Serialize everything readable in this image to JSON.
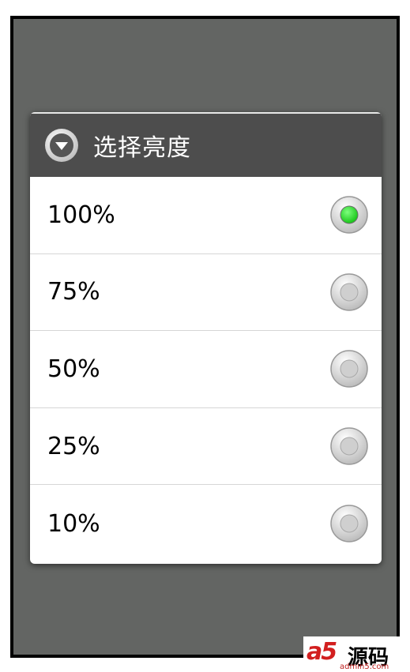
{
  "dialog": {
    "title": "选择亮度",
    "title_icon": "chevron-down-circle-icon",
    "options": [
      {
        "label": "100%",
        "selected": true
      },
      {
        "label": "75%",
        "selected": false
      },
      {
        "label": "50%",
        "selected": false
      },
      {
        "label": "25%",
        "selected": false
      },
      {
        "label": "10%",
        "selected": false
      }
    ]
  },
  "colors": {
    "backdrop": "#636563",
    "title_bar": "#4d4d4d",
    "radio_selected": "#22dd22"
  },
  "watermark": {
    "logo": "a5",
    "brand": "源码",
    "url": "admin5.com"
  }
}
